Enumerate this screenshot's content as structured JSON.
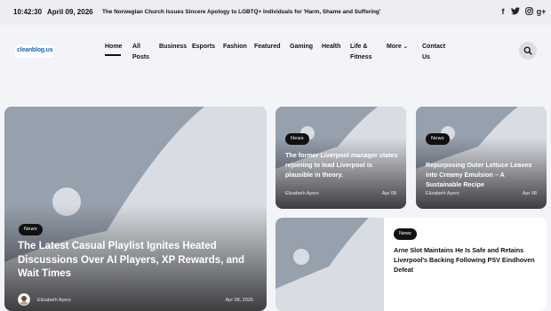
{
  "topbar": {
    "time": "10:42:30",
    "date": "April 09, 2026",
    "ticker": "The Norwegian Church Issues Sincere Apology to LGBTQ+ Individuals for 'Harm, Shame and Suffering'",
    "social": [
      {
        "name": "facebook-icon",
        "glyph": "f"
      },
      {
        "name": "twitter-icon",
        "glyph": "t"
      },
      {
        "name": "instagram-icon",
        "glyph": "◎"
      },
      {
        "name": "google-plus-icon",
        "glyph": "g+"
      }
    ]
  },
  "header": {
    "logo_text": "cleanblog.us",
    "nav": [
      {
        "line1": "Home",
        "line2": ""
      },
      {
        "line1": "All",
        "line2": "Posts"
      },
      {
        "line1": "Business",
        "line2": ""
      },
      {
        "line1": "Esports",
        "line2": ""
      },
      {
        "line1": "Fashion",
        "line2": ""
      },
      {
        "line1": "Featured",
        "line2": ""
      },
      {
        "line1": "Gaming",
        "line2": ""
      },
      {
        "line1": "Health",
        "line2": ""
      },
      {
        "line1": "Life &",
        "line2": "Fitness"
      },
      {
        "line1": "More",
        "line2": ""
      },
      {
        "line1": "Contact",
        "line2": "Us"
      }
    ],
    "more_chevron": "⌄"
  },
  "cards": {
    "featured": {
      "badge": "News",
      "title": "The Latest Casual Playlist Ignites Heated Discussions Over AI Players, XP Rewards, and Wait Times",
      "author": "Elizabeth Ayers",
      "date": "Apr 08, 2026"
    },
    "top_middle": {
      "badge": "News",
      "title": "The former Liverpool manager states rejoining to lead Liverpool is plausible in theory.",
      "author": "Elizabeth Ayers",
      "date": "Apr 08"
    },
    "top_right": {
      "badge": "News",
      "title": "Repurposing Outer Lettuce Leaves into Creamy Emulsion – A Sustainable Recipe",
      "author": "Elizabeth Ayers",
      "date": "Apr 08"
    },
    "bottom_wide": {
      "badge": "News",
      "title": "Arne Slot Maintains He Is Safe and Retains Liverpool's Backing Following PSV Eindhoven Defeat"
    }
  },
  "colors": {
    "accent": "#111111",
    "placeholder": "#97a0ad",
    "placeholder_shape": "#d9dde3"
  }
}
